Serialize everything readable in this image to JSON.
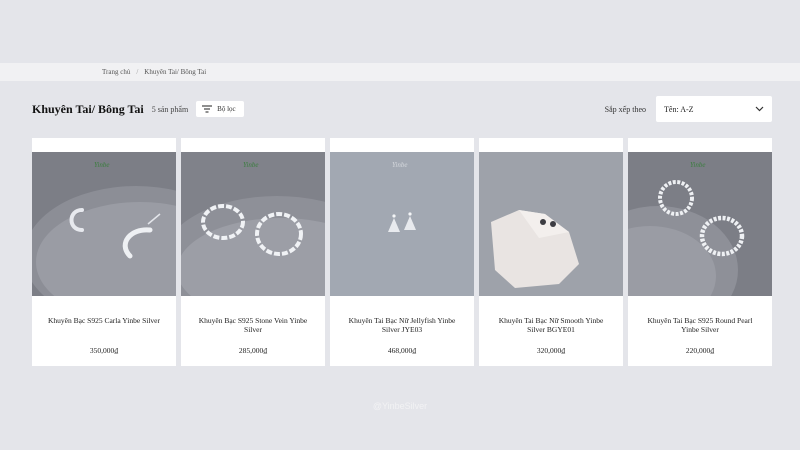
{
  "breadcrumb": {
    "home": "Trang chủ",
    "separator": "/",
    "current": "Khuyên Tai/ Bông Tai"
  },
  "toolbar": {
    "title": "Khuyên Tai/ Bông Tai",
    "count": "5 sản phẩm",
    "filter_label": "Bộ lọc",
    "sort_label": "Sắp xếp theo",
    "sort_value": "Tên: A-Z"
  },
  "products": [
    {
      "name": "Khuyên Bạc S925 Carla Yinbe Silver",
      "price": "350,000₫",
      "brand_mark": "Yinbe"
    },
    {
      "name": "Khuyên Bạc S925 Stone Vein Yinbe Silver",
      "price": "285,000₫",
      "brand_mark": "Yinbe"
    },
    {
      "name": "Khuyên Tai Bạc Nữ Jellyfish Yinbe Silver JYE03",
      "price": "468,000₫",
      "brand_mark": "Yinbe"
    },
    {
      "name": "Khuyên Tai Bạc Nữ Smooth Yinbe Silver BGYE01",
      "price": "320,000₫",
      "brand_mark": ""
    },
    {
      "name": "Khuyên Tai Bạc S925 Round Pearl Yinbe Silver",
      "price": "220,000₫",
      "brand_mark": "Yinbe"
    }
  ],
  "watermark": "@YinbeSilver",
  "colors": {
    "page_bg": "#e4e5ea",
    "card_bg": "#ffffff",
    "photo_bg_dark": "#7c7e86",
    "photo_bg_blue": "#a2a8b2"
  }
}
